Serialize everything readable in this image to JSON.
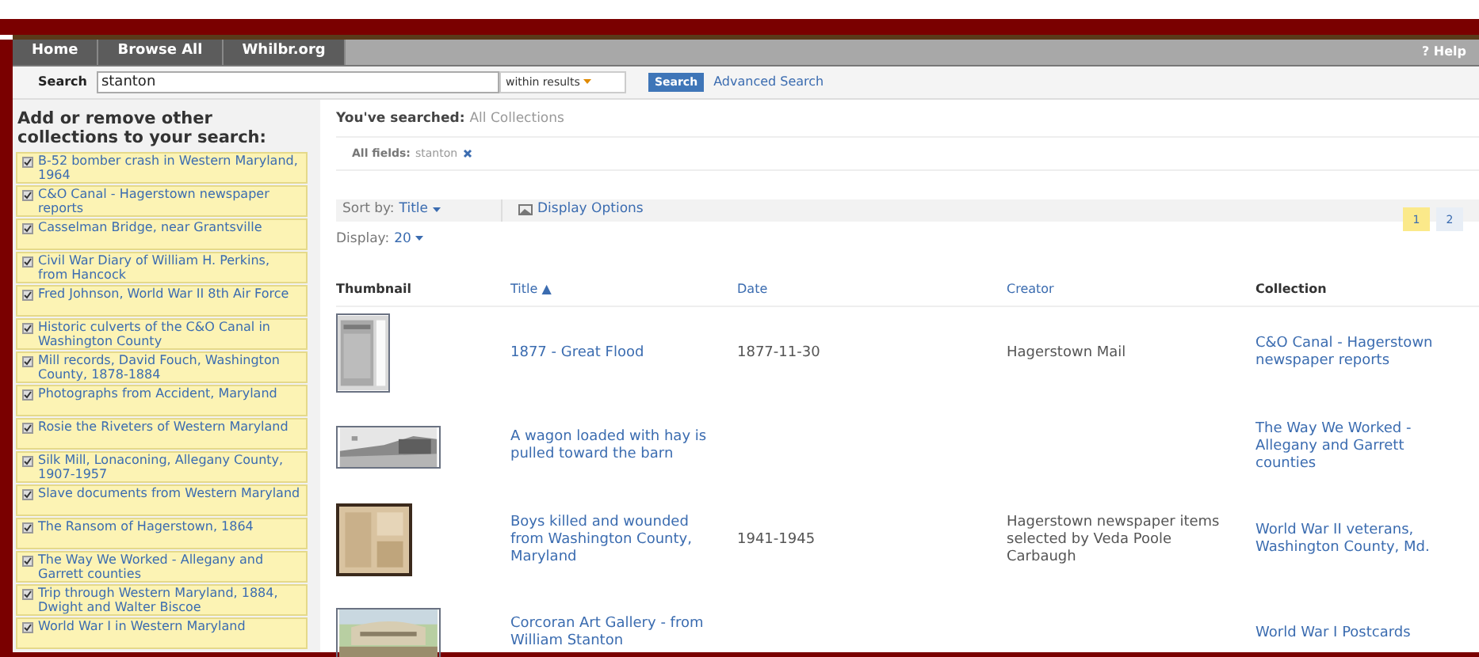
{
  "nav": {
    "tabs": [
      {
        "label": "Home",
        "selected": false
      },
      {
        "label": "Browse All",
        "selected": false
      },
      {
        "label": "Whilbr.org",
        "selected": false
      }
    ],
    "help": "? Help"
  },
  "search": {
    "label": "Search",
    "value": "stanton",
    "scope": "within results",
    "button": "Search",
    "advanced": "Advanced Search"
  },
  "sidebar": {
    "title": "Add or remove other collections to your search:",
    "items": [
      {
        "label": "B-52 bomber crash in Western Maryland, 1964",
        "checked": true
      },
      {
        "label": "C&O Canal - Hagerstown newspaper reports",
        "checked": true
      },
      {
        "label": "Casselman Bridge, near Grantsville",
        "checked": true
      },
      {
        "label": "Civil War Diary of William H. Perkins, from Hancock",
        "checked": true
      },
      {
        "label": "Fred Johnson, World War II 8th Air Force",
        "checked": true
      },
      {
        "label": "Historic culverts of the C&O Canal in Washington County",
        "checked": true
      },
      {
        "label": "Mill records, David Fouch, Washington County, 1878-1884",
        "checked": true
      },
      {
        "label": "Photographs from Accident, Maryland",
        "checked": true
      },
      {
        "label": "Rosie the Riveters of Western Maryland",
        "checked": true
      },
      {
        "label": "Silk Mill, Lonaconing, Allegany County, 1907-1957",
        "checked": true
      },
      {
        "label": "Slave documents from Western Maryland",
        "checked": true
      },
      {
        "label": "The Ransom of Hagerstown, 1864",
        "checked": true
      },
      {
        "label": "The Way We Worked - Allegany and Garrett counties",
        "checked": true
      },
      {
        "label": "Trip through Western Maryland, 1884, Dwight and Walter Biscoe",
        "checked": true
      },
      {
        "label": "World War I in Western Maryland",
        "checked": true
      }
    ]
  },
  "searched": {
    "label": "You've searched:",
    "value": "All Collections",
    "filter_label": "All fields:",
    "filter_value": "stanton"
  },
  "toolbar": {
    "sort_label": "Sort by:",
    "sort_value": "Title",
    "display_options": "Display Options",
    "display_label": "Display:",
    "display_value": "20",
    "pages": [
      {
        "label": "1",
        "selected": true
      },
      {
        "label": "2",
        "selected": false
      }
    ]
  },
  "table": {
    "columns": [
      {
        "label": "Thumbnail",
        "kind": "plain"
      },
      {
        "label": "Title ▲",
        "kind": "link"
      },
      {
        "label": "Date",
        "kind": "link"
      },
      {
        "label": "Creator",
        "kind": "link"
      },
      {
        "label": "Collection",
        "kind": "plain"
      }
    ],
    "rows": [
      {
        "thumbnail": {
          "kind": "document"
        },
        "title": "1877 - Great Flood",
        "date": "1877-11-30",
        "creator": "Hagerstown Mail",
        "collection": "C&O Canal - Hagerstown newspaper reports"
      },
      {
        "title": "A wagon loaded with hay is pulled toward the barn",
        "collection": "The Way We Worked - Allegany and Garrett counties"
      },
      {
        "thumbnail": {
          "kind": "clipping"
        },
        "title": "Boys killed and wounded from Washington County, Maryland",
        "date": "1941-1945",
        "creator": "Hagerstown newspaper items selected by Veda Poole Carbaugh",
        "collection": "World War II veterans, Washington County, Md."
      },
      {
        "thumbnail": {
          "kind": "postcard"
        },
        "title": "Corcoran Art Gallery - from William Stanton",
        "collection": "World War I Postcards"
      }
    ]
  }
}
